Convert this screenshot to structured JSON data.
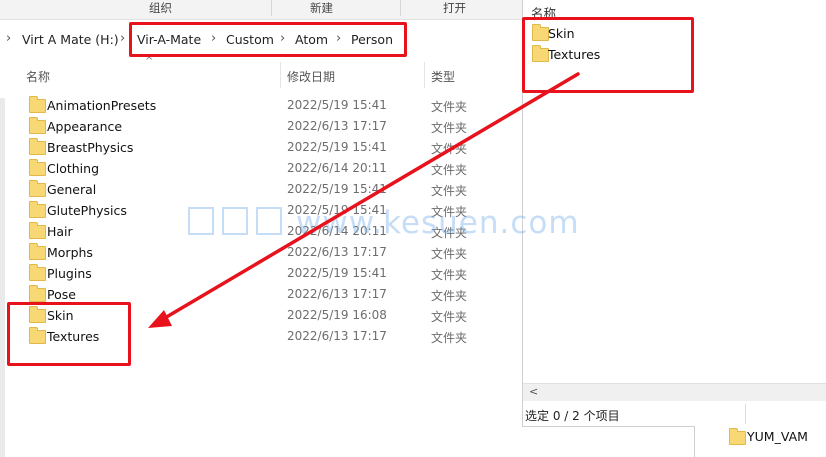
{
  "ribbon": {
    "group_label": "组织",
    "new_label": "新建",
    "open_label": "打开"
  },
  "address": {
    "crumbs": [
      "Virt A Mate (H:)",
      "Vir-A-Mate",
      "Custom",
      "Atom",
      "Person"
    ]
  },
  "columns": {
    "name": "名称",
    "date": "修改日期",
    "type": "类型"
  },
  "rows": [
    {
      "name": "AnimationPresets",
      "date": "2022/5/19 15:41",
      "type": "文件夹"
    },
    {
      "name": "Appearance",
      "date": "2022/6/13 17:17",
      "type": "文件夹"
    },
    {
      "name": "BreastPhysics",
      "date": "2022/5/19 15:41",
      "type": "文件夹"
    },
    {
      "name": "Clothing",
      "date": "2022/6/14 20:11",
      "type": "文件夹"
    },
    {
      "name": "General",
      "date": "2022/5/19 15:41",
      "type": "文件夹"
    },
    {
      "name": "GlutePhysics",
      "date": "2022/5/19 15:41",
      "type": "文件夹"
    },
    {
      "name": "Hair",
      "date": "2022/6/14 20:11",
      "type": "文件夹"
    },
    {
      "name": "Morphs",
      "date": "2022/6/13 17:17",
      "type": "文件夹"
    },
    {
      "name": "Plugins",
      "date": "2022/5/19 15:41",
      "type": "文件夹"
    },
    {
      "name": "Pose",
      "date": "2022/6/13 17:17",
      "type": "文件夹"
    },
    {
      "name": "Skin",
      "date": "2022/5/19 16:08",
      "type": "文件夹"
    },
    {
      "name": "Textures",
      "date": "2022/6/13 17:17",
      "type": "文件夹"
    }
  ],
  "right_window": {
    "header": "名称",
    "items": [
      "Skin",
      "Textures"
    ],
    "status": "选定 0 / 2 个项目",
    "scroll_left": "<"
  },
  "bottom_pane": {
    "item": "YUM_VAM"
  },
  "watermark": "www.kesuen.com",
  "colors": {
    "annotation_red": "#e8121c",
    "folder_yellow": "#f8d775"
  },
  "icons": {
    "folder": "folder-icon",
    "chevron": "chevron-right-icon",
    "sort": "sort-up-icon"
  }
}
